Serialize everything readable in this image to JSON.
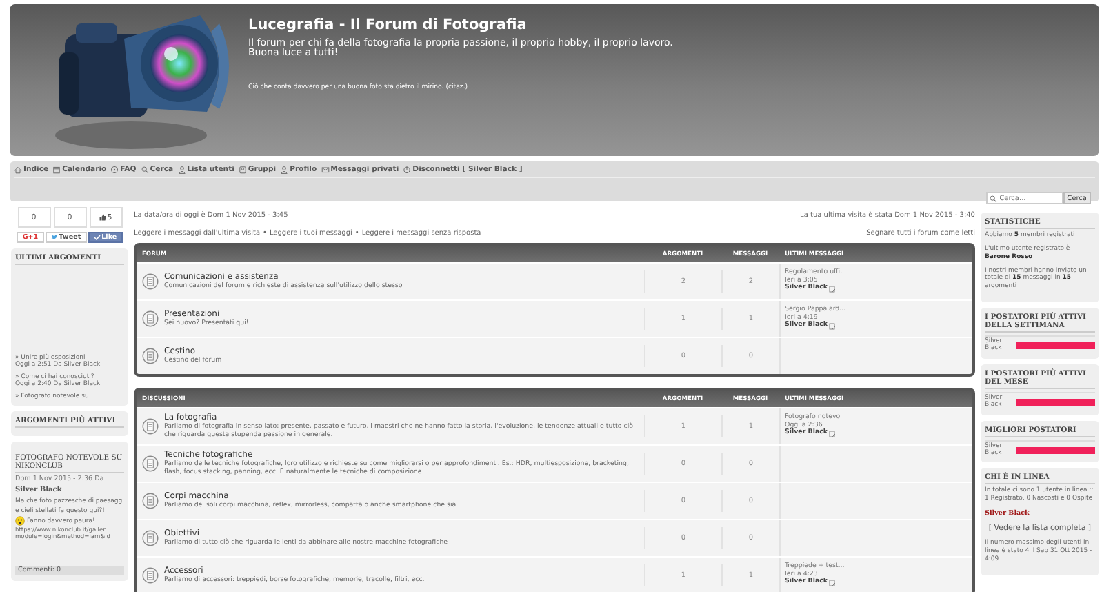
{
  "header": {
    "title": "Lucegrafia - Il Forum di Fotografia",
    "tagline": [
      "Il forum per chi fa della fotografia la propria passione, il proprio hobby, il proprio lavoro.",
      "Buona luce a tutti!"
    ],
    "quote": "Ciò che conta davvero per una buona foto sta dietro il mirino. (citaz.)"
  },
  "nav": [
    {
      "label": "Indice"
    },
    {
      "label": "Calendario"
    },
    {
      "label": "FAQ"
    },
    {
      "label": "Cerca"
    },
    {
      "label": "Lista utenti"
    },
    {
      "label": "Gruppi"
    },
    {
      "label": "Profilo"
    },
    {
      "label": "Messaggi privati"
    },
    {
      "label": "Disconnetti [ Silver Black ]"
    }
  ],
  "search": {
    "placeholder": "Cerca...",
    "button": "Cerca"
  },
  "share": {
    "counters": [
      {
        "value": "0",
        "kind": "plain"
      },
      {
        "value": "0",
        "kind": "plain"
      },
      {
        "value": "5",
        "kind": "thumb"
      }
    ],
    "buttons": [
      {
        "label": "G+1",
        "kind": "gplus"
      },
      {
        "label": "Tweet",
        "kind": "tweet"
      },
      {
        "label": "Like",
        "kind": "like"
      }
    ]
  },
  "latest_topics": {
    "title": "ULTIMI ARGOMENTI",
    "items": [
      {
        "title": "» Unire più esposizioni",
        "meta": "Oggi a 2:51 Da Silver Black"
      },
      {
        "title": "» Come ci hai conosciuti?",
        "meta": "Oggi a 2:40 Da Silver Black"
      },
      {
        "title": "» Fotografo notevole su"
      }
    ]
  },
  "active_topics": {
    "title": "ARGOMENTI PIÙ ATTIVI"
  },
  "featured_post": {
    "title": "FOTOGRAFO NOTEVOLE SU NIKONCLUB",
    "meta": "Dom 1 Nov 2015 - 2:36 Da",
    "author": "Silver Black",
    "text_before": "Ma che foto pazzesche di paesaggi e cieli stellati fa questo qui?!",
    "text_after": "Fanno davvero paura!",
    "url_lines": [
      "https://www.nikonclub.it/galler",
      "module=login&method=iam&id"
    ],
    "comments": "Commenti: 0"
  },
  "info": {
    "today": "La data/ora di oggi è Dom 1 Nov 2015 - 3:45",
    "last_visit": "La tua ultima visita è stata Dom 1 Nov 2015 - 3:40",
    "separator": "•",
    "links": [
      "Leggere i messaggi dall'ultima visita",
      "Leggere i tuoi messaggi",
      "Leggere i messaggi senza risposta"
    ],
    "mark_read": "Segnare tutti i forum come letti"
  },
  "categories": [
    {
      "columns": [
        "FORUM",
        "ARGOMENTI",
        "MESSAGGI",
        "ULTIMI MESSAGGI"
      ],
      "rows": [
        {
          "name": "Comunicazioni e assistenza",
          "description": "Comunicazioni del forum e richieste di assistenza sull'utilizzo dello stesso",
          "topics": "2",
          "posts": "2",
          "last": {
            "title": "Regolamento uffi...",
            "time": "Ieri a 3:05",
            "author": "Silver Black"
          }
        },
        {
          "name": "Presentazioni",
          "description": "Sei nuovo? Presentati qui!",
          "topics": "1",
          "posts": "1",
          "last": {
            "title": "Sergio Pappalard...",
            "time": "Ieri a 4:19",
            "author": "Silver Black"
          }
        },
        {
          "name": "Cestino",
          "description": "Cestino del forum",
          "topics": "0",
          "posts": "0"
        }
      ]
    },
    {
      "columns": [
        "DISCUSSIONI",
        "ARGOMENTI",
        "MESSAGGI",
        "ULTIMI MESSAGGI"
      ],
      "rows": [
        {
          "name": "La fotografia",
          "description": "Parliamo di fotografia in senso lato: presente, passato e futuro, i maestri che ne hanno fatto la storia, l'evoluzione, le tendenze attuali e tutto ciò che riguarda questa stupenda passione in generale.",
          "topics": "1",
          "posts": "1",
          "last": {
            "title": "Fotografo notevo...",
            "time": "Oggi a 2:36",
            "author": "Silver Black"
          }
        },
        {
          "name": "Tecniche fotografiche",
          "description": "Parliamo delle tecniche fotografiche, loro utilizzo e richieste su come migliorarsi o per approfondimenti. Es.: HDR, multiesposizione, bracketing, flash, focus stacking, panning, ecc. E naturalmente le tecniche di composizione",
          "topics": "0",
          "posts": "0"
        },
        {
          "name": "Corpi macchina",
          "description": "Parliamo dei soli corpi macchina, reflex, mirrorless, compatta o anche smartphone che sia",
          "topics": "0",
          "posts": "0"
        },
        {
          "name": "Obiettivi",
          "description": "Parliamo di tutto ciò che riguarda le lenti da abbinare alle nostre macchine fotografiche",
          "topics": "0",
          "posts": "0"
        },
        {
          "name": "Accessori",
          "description": "Parliamo di accessori: treppiedi, borse fotografiche, memorie, tracolle, filtri, ecc.",
          "topics": "1",
          "posts": "1",
          "last": {
            "title": "Treppiede + test...",
            "time": "Ieri a 4:23",
            "author": "Silver Black"
          }
        }
      ]
    }
  ],
  "stats": {
    "title": "STATISTICHE",
    "paragraphs": [
      "Abbiamo **5** membri registrati",
      "L'ultimo utente registrato è **Barone Rosso**",
      "I nostri membri hanno inviato un totale di **15** messaggi in **15** argomenti"
    ]
  },
  "posters": [
    {
      "title": "I POSTATORI PIÙ ATTIVI DELLA SETTIMANA",
      "entries": [
        {
          "name": "Silver Black",
          "level": 1
        }
      ]
    },
    {
      "title": "I POSTATORI PIÙ ATTIVI DEL MESE",
      "entries": [
        {
          "name": "Silver Black",
          "level": 1
        }
      ]
    },
    {
      "title": "MIGLIORI POSTATORI",
      "entries": [
        {
          "name": "Silver Black",
          "level": 1
        }
      ]
    }
  ],
  "online": {
    "title": "CHI È IN LINEA",
    "text": "In totale ci sono 1 utente in linea :: 1 Registrato, 0 Nascosti e 0 Ospite",
    "user": "Silver Black",
    "link": "[ Vedere la lista completa ]",
    "record": "Il numero massimo degli utenti in linea è stato 4 il Sab 31 Ott 2015 - 4:09"
  }
}
